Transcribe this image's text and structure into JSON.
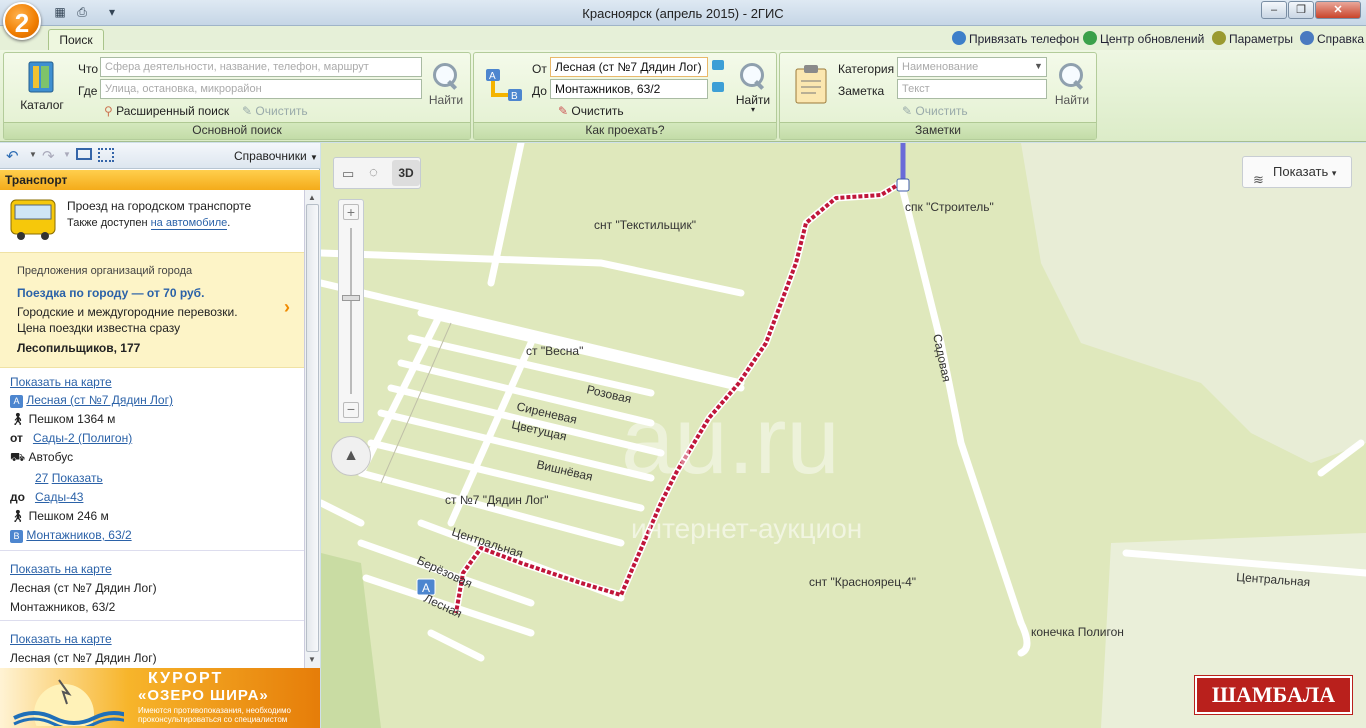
{
  "window": {
    "title": "Красноярск (апрель 2015) - 2ГИС",
    "logo": "2"
  },
  "ribbon": {
    "tab": "Поиск",
    "links": [
      {
        "label": "Привязать телефон",
        "icon": "phone-icon"
      },
      {
        "label": "Центр обновлений",
        "icon": "refresh-icon"
      },
      {
        "label": "Параметры",
        "icon": "gear-icon"
      },
      {
        "label": "Справка",
        "icon": "help-icon"
      }
    ],
    "main_search": {
      "catalog": "Каталог",
      "what_label": "Что",
      "what_placeholder": "Сфера деятельности, название, телефон, маршрут",
      "where_label": "Где",
      "where_placeholder": "Улица, остановка, микрорайон",
      "advanced": "Расширенный поиск",
      "clear": "Очистить",
      "find": "Найти",
      "group_label": "Основной поиск"
    },
    "route": {
      "from_label": "От",
      "from_value": "Лесная (ст №7 Дядин Лог)",
      "to_label": "До",
      "to_value": "Монтажников, 63/2",
      "clear": "Очистить",
      "find": "Найти",
      "group_label": "Как проехать?"
    },
    "notes": {
      "category_label": "Категория",
      "category_placeholder": "Наименование",
      "note_label": "Заметка",
      "note_placeholder": "Текст",
      "clear": "Очистить",
      "find": "Найти",
      "group_label": "Заметки"
    }
  },
  "left_panel": {
    "toolbar_right": "Справочники",
    "header": "Транспорт",
    "transport": {
      "title": "Проезд на городском транспорте",
      "also": "Также доступен",
      "also_link": "на автомобиле",
      "dot": "."
    },
    "promo": {
      "caption": "Предложения организаций города",
      "title": "Поездка по городу — от 70 руб.",
      "line1": "Городские и междугородние перевозки.",
      "line2": "Цена поездки известна сразу",
      "address": "Лесопильщиков, 177"
    },
    "route1": {
      "show": "Показать на карте",
      "start": "Лесная (ст №7 Дядин Лог)",
      "walk1": "Пешком 1364 м",
      "from_word": "от",
      "from_stop": "Сады-2 (Полигон)",
      "mode": "Автобус",
      "bus_num": "27",
      "bus_show": "Показать",
      "to_word": "до",
      "to_stop": "Сады-43",
      "walk2": "Пешком 246 м",
      "end": "Монтажников, 63/2"
    },
    "route2": {
      "show": "Показать на карте",
      "line1": "Лесная (ст №7 Дядин Лог)",
      "line2": "Монтажников, 63/2"
    },
    "route3": {
      "show": "Показать на карте",
      "line1": "Лесная (ст №7 Дядин Лог)"
    },
    "ad": {
      "line1": "КУРОРТ",
      "line2": "«ОЗЕРО ШИРА»",
      "line3": "Имеются противопоказания, необходимо",
      "line4": "проконсультироваться со специалистом"
    }
  },
  "map": {
    "show_button": "Показать",
    "mode_3d": "3D",
    "watermark1": "au.ru",
    "watermark2": "интернет-аукцион",
    "ad": "ШАМБАЛА",
    "labels": {
      "tekst": "снт \"Текстильщик\"",
      "stroitel": "спк \"Строитель\"",
      "vesna": "ст \"Весна\"",
      "rozovaya": "Розовая",
      "sirenevaya": "Сиреневая",
      "tsvetushchaya": "Цветущая",
      "vishnevaya": "Вишнёвая",
      "dyadin": "ст №7 \"Дядин Лог\"",
      "tsentralnaya": "Центральная",
      "berezovaya": "Берёзовая",
      "lesnaya": "Лесная",
      "sadovaya": "Садовая",
      "krasnoyarets": "снт \"Красноярец-4\"",
      "tsentralnaya2": "Центральная",
      "konechka": "конечка Полигон",
      "marker_a": "A"
    }
  }
}
